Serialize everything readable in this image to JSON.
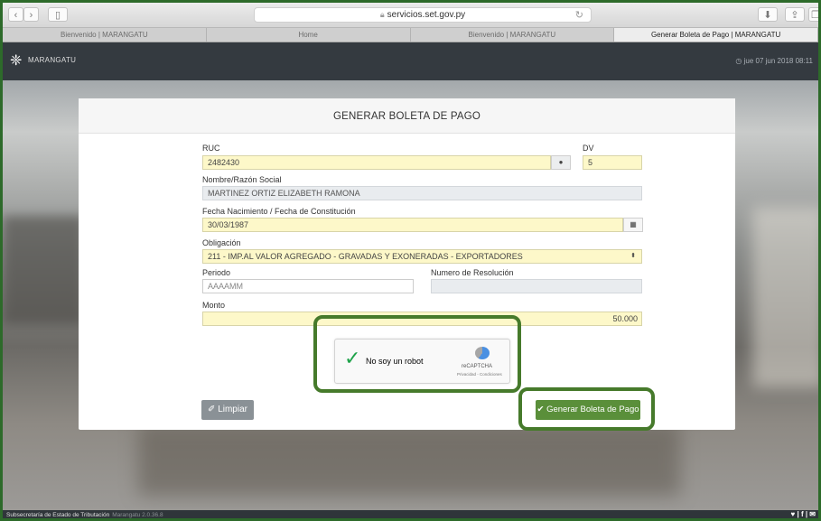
{
  "browser": {
    "url": "servicios.set.gov.py",
    "tabs": [
      "Bienvenido | MARANGATU",
      "Home",
      "Bienvenido | MARANGATU",
      "Generar Boleta de Pago | MARANGATU"
    ],
    "active_tab": 3
  },
  "app": {
    "brand": "MARANGATU",
    "datetime": "jue 07 jun 2018 08:11"
  },
  "form": {
    "title": "GENERAR BOLETA DE PAGO",
    "ruc": {
      "label": "RUC",
      "value": "2482430"
    },
    "dv": {
      "label": "DV",
      "value": "5"
    },
    "nombre": {
      "label": "Nombre/Razón Social",
      "value": "MARTINEZ ORTIZ ELIZABETH RAMONA"
    },
    "fecha": {
      "label": "Fecha Nacimiento / Fecha de Constitución",
      "value": "30/03/1987"
    },
    "obligacion": {
      "label": "Obligación",
      "value": "211 - IMP.AL VALOR AGREGADO - GRAVADAS Y EXONERADAS - EXPORTADORES"
    },
    "periodo": {
      "label": "Periodo",
      "placeholder": "AAAAMM"
    },
    "resolucion": {
      "label": "Numero de Resolución",
      "value": ""
    },
    "monto": {
      "label": "Monto",
      "value": "50.000"
    }
  },
  "captcha": {
    "label": "No soy un robot",
    "brand": "reCAPTCHA",
    "links": "Privacidad - Condiciones"
  },
  "buttons": {
    "clear": "Limpiar",
    "submit": "Generar Boleta de Pago"
  },
  "footer": {
    "org": "Subsecretaría de Estado de Tributación",
    "version": "Marangatu 2.0.36.8",
    "social": "♥ | f | ✉"
  },
  "colors": {
    "highlight": "#467a2b",
    "submit": "#5a8f3a",
    "input_yellow": "#fdf8c9"
  }
}
